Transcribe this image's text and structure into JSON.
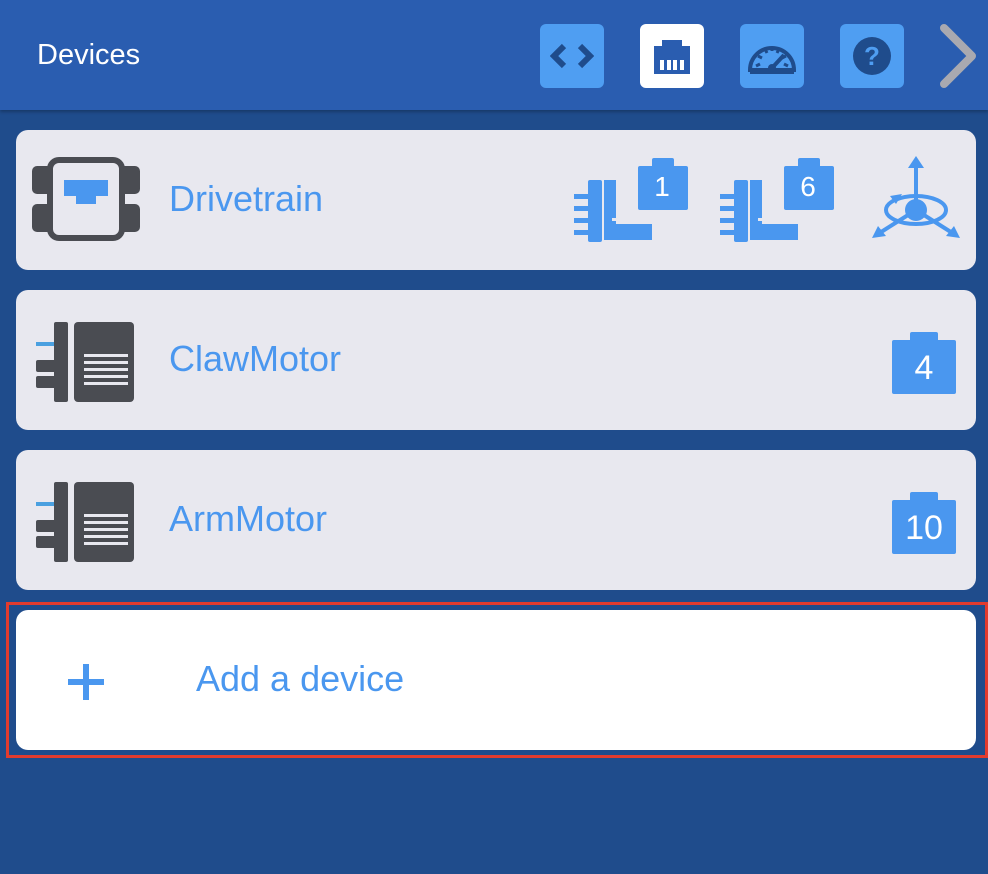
{
  "header": {
    "title": "Devices",
    "buttons": [
      {
        "name": "code-view",
        "icon": "code-brackets-icon",
        "active": false
      },
      {
        "name": "devices",
        "icon": "ethernet-port-icon",
        "active": true
      },
      {
        "name": "dashboard",
        "icon": "speedometer-icon",
        "active": false
      },
      {
        "name": "help",
        "icon": "question-mark-icon",
        "active": false
      }
    ],
    "next_icon": "chevron-right-icon"
  },
  "devices": [
    {
      "name": "Drivetrain",
      "icon": "drivetrain-icon",
      "ports": [
        "1",
        "6"
      ],
      "extra_icon": "gyro-sensor-icon"
    },
    {
      "name": "ClawMotor",
      "icon": "motor-icon",
      "ports": [
        "4"
      ]
    },
    {
      "name": "ArmMotor",
      "icon": "motor-icon",
      "ports": [
        "10"
      ]
    }
  ],
  "add_device": {
    "label": "Add a device",
    "icon": "plus-icon"
  },
  "colors": {
    "background": "#1f4c8c",
    "header": "#2a5db0",
    "accent": "#4a97ef",
    "card": "#e8e8ef",
    "highlight": "#e23b2e"
  }
}
